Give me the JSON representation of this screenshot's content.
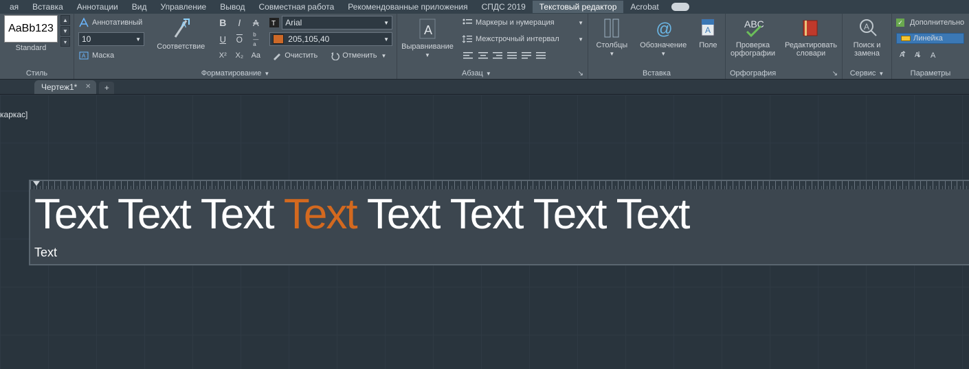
{
  "menu": {
    "items": [
      "ая",
      "Вставка",
      "Аннотации",
      "Вид",
      "Управление",
      "Вывод",
      "Совместная работа",
      "Рекомендованные приложения",
      "СПДС 2019",
      "Текстовый редактор",
      "Acrobat"
    ],
    "active_index": 9
  },
  "style_panel": {
    "preview_text": "AaBb123",
    "style_name": "Standard",
    "title": "Стиль"
  },
  "format_panel": {
    "annotative_label": "Аннотативный",
    "height_value": "10",
    "mask_label": "Маска",
    "match_label": "Соответствие",
    "font_value": "Arial",
    "color_value": "205,105,40",
    "clear_label": "Очистить",
    "cancel_label": "Отменить",
    "title": "Форматирование"
  },
  "align_panel": {
    "big_label": "Выравнивание"
  },
  "paragraph_panel": {
    "bullets_label": "Маркеры и нумерация",
    "spacing_label": "Межстрочный интервал",
    "title": "Абзац"
  },
  "insert_panel": {
    "columns_label": "Столбцы",
    "symbol_label": "Обозначение",
    "field_label": "Поле",
    "title": "Вставка"
  },
  "spell_panel": {
    "check_label": "Проверка орфографии",
    "edit_label": "Редактировать словари",
    "title": "Орфография"
  },
  "find_panel": {
    "label": "Поиск и замена",
    "title": "Сервис"
  },
  "options_panel": {
    "extra_label": "Дополнительно",
    "ruler_label": "Линейка",
    "title": "Параметры"
  },
  "tabs": {
    "file_name": "Чертеж1*"
  },
  "canvas": {
    "layer_label": "каркас]",
    "words": [
      "Text",
      "Text",
      "Text",
      "Text",
      "Text",
      "Text",
      "Text",
      "Text"
    ],
    "orange_index": 3,
    "small_text": "Text"
  }
}
